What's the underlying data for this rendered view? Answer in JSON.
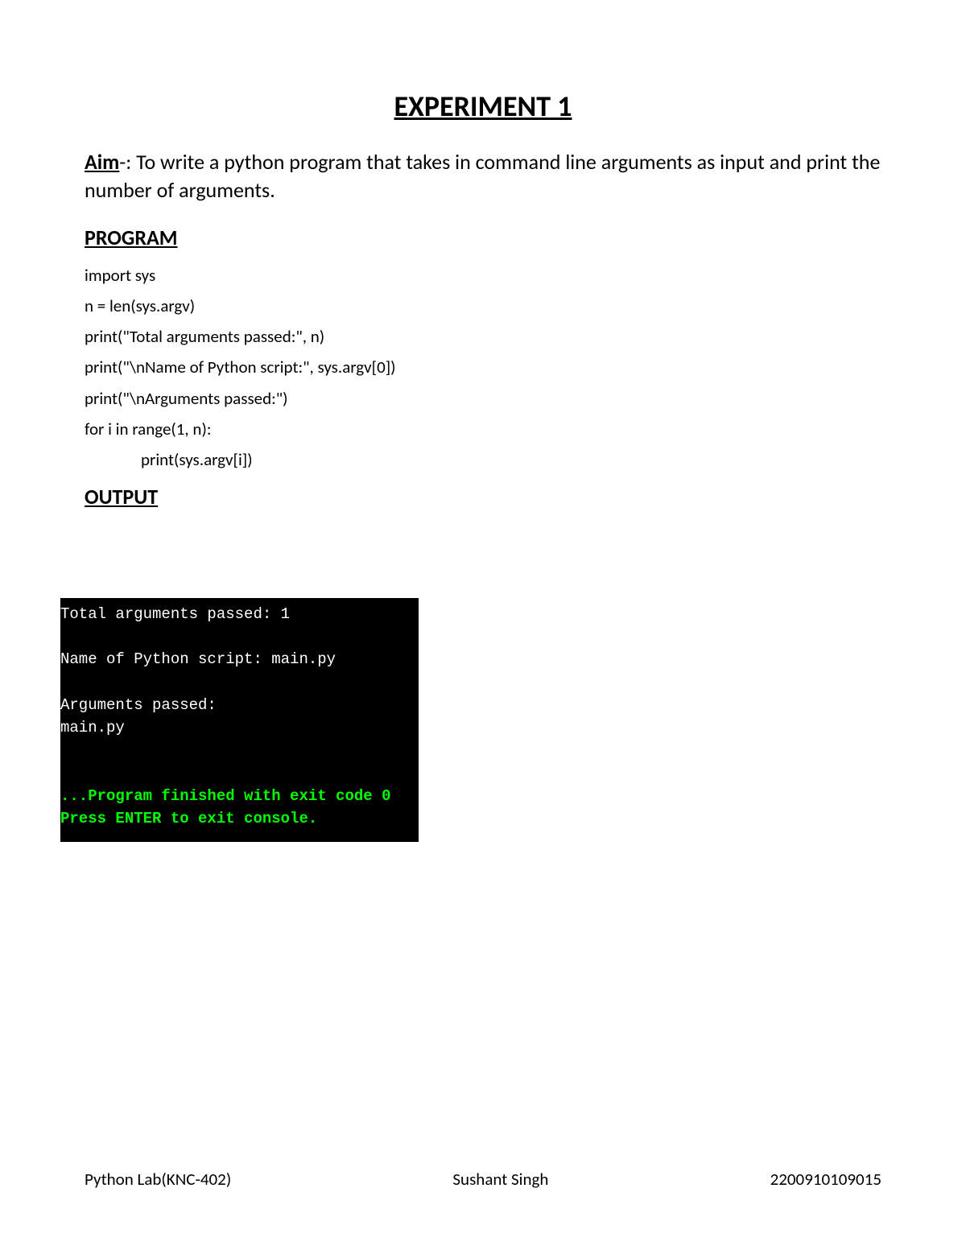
{
  "title": "EXPERIMENT 1",
  "aim": {
    "label": "Aim",
    "text": "-: To write a python program that takes in command line arguments as input and print the number of arguments."
  },
  "program": {
    "heading": "PROGRAM",
    "lines": [
      "import sys",
      "n = len(sys.argv)",
      "print(\"Total arguments passed:\", n)",
      "print(\"\\nName of Python script:\", sys.argv[0])",
      "print(\"\\nArguments passed:\")",
      "for i in range(1, n):",
      "print(sys.argv[i])"
    ]
  },
  "output": {
    "heading": "OUTPUT",
    "terminal": {
      "line1": "Total arguments passed: 1",
      "line2": "Name of Python script: main.py",
      "line3": "Arguments passed:",
      "line4": "main.py",
      "line5": "...Program finished with exit code 0",
      "line6": "Press ENTER to exit console."
    }
  },
  "footer": {
    "left": "Python Lab(KNC-402)",
    "center": "Sushant Singh",
    "right": "2200910109015"
  }
}
